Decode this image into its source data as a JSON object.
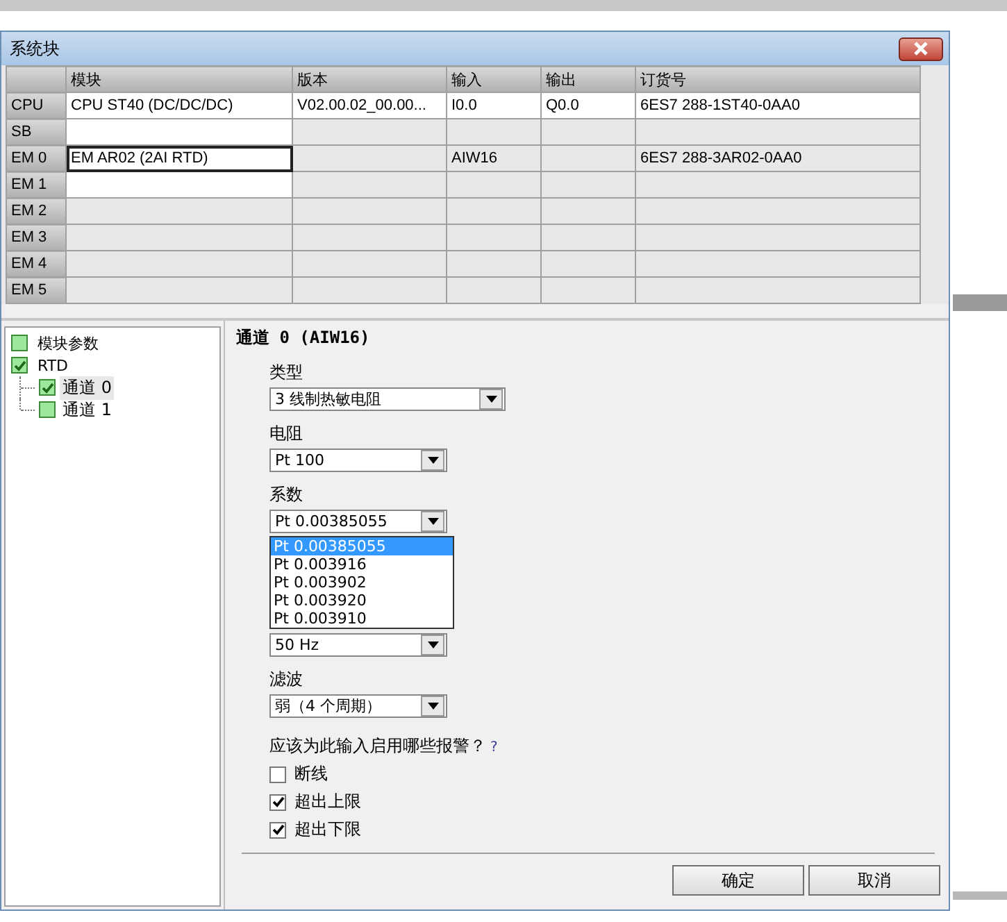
{
  "window": {
    "title": "系统块"
  },
  "table": {
    "columns": [
      "模块",
      "版本",
      "输入",
      "输出",
      "订货号"
    ],
    "rows": [
      {
        "header": "CPU",
        "cells": [
          {
            "text": "CPU ST40 (DC/DC/DC)",
            "editable": true,
            "focused": false
          },
          {
            "text": "V02.00.02_00.00...",
            "editable": true,
            "focused": false
          },
          {
            "text": "I0.0",
            "editable": true,
            "focused": false
          },
          {
            "text": "Q0.0",
            "editable": true,
            "focused": false
          },
          {
            "text": "6ES7 288-1ST40-0AA0",
            "editable": true,
            "focused": false
          }
        ]
      },
      {
        "header": "SB",
        "cells": [
          {
            "text": "",
            "editable": true,
            "focused": false
          },
          {
            "text": "",
            "editable": false,
            "focused": false
          },
          {
            "text": "",
            "editable": false,
            "focused": false
          },
          {
            "text": "",
            "editable": false,
            "focused": false
          },
          {
            "text": "",
            "editable": false,
            "focused": false
          }
        ]
      },
      {
        "header": "EM 0",
        "cells": [
          {
            "text": "EM AR02 (2AI RTD)",
            "editable": true,
            "focused": true
          },
          {
            "text": "",
            "editable": false,
            "focused": false
          },
          {
            "text": "AIW16",
            "editable": false,
            "focused": false
          },
          {
            "text": "",
            "editable": false,
            "focused": false
          },
          {
            "text": "6ES7 288-3AR02-0AA0",
            "editable": false,
            "focused": false
          }
        ]
      },
      {
        "header": "EM 1",
        "cells": [
          {
            "text": "",
            "editable": true,
            "focused": false
          },
          {
            "text": "",
            "editable": false,
            "focused": false
          },
          {
            "text": "",
            "editable": false,
            "focused": false
          },
          {
            "text": "",
            "editable": false,
            "focused": false
          },
          {
            "text": "",
            "editable": false,
            "focused": false
          }
        ]
      },
      {
        "header": "EM 2",
        "cells": [
          {
            "text": "",
            "editable": false,
            "focused": false
          },
          {
            "text": "",
            "editable": false,
            "focused": false
          },
          {
            "text": "",
            "editable": false,
            "focused": false
          },
          {
            "text": "",
            "editable": false,
            "focused": false
          },
          {
            "text": "",
            "editable": false,
            "focused": false
          }
        ]
      },
      {
        "header": "EM 3",
        "cells": [
          {
            "text": "",
            "editable": false,
            "focused": false
          },
          {
            "text": "",
            "editable": false,
            "focused": false
          },
          {
            "text": "",
            "editable": false,
            "focused": false
          },
          {
            "text": "",
            "editable": false,
            "focused": false
          },
          {
            "text": "",
            "editable": false,
            "focused": false
          }
        ]
      },
      {
        "header": "EM 4",
        "cells": [
          {
            "text": "",
            "editable": false,
            "focused": false
          },
          {
            "text": "",
            "editable": false,
            "focused": false
          },
          {
            "text": "",
            "editable": false,
            "focused": false
          },
          {
            "text": "",
            "editable": false,
            "focused": false
          },
          {
            "text": "",
            "editable": false,
            "focused": false
          }
        ]
      },
      {
        "header": "EM 5",
        "cells": [
          {
            "text": "",
            "editable": false,
            "focused": false
          },
          {
            "text": "",
            "editable": false,
            "focused": false
          },
          {
            "text": "",
            "editable": false,
            "focused": false
          },
          {
            "text": "",
            "editable": false,
            "focused": false
          },
          {
            "text": "",
            "editable": false,
            "focused": false
          }
        ]
      }
    ]
  },
  "tree": [
    {
      "label": "模块参数",
      "checked": false,
      "selected": false
    },
    {
      "label": "RTD",
      "checked": true,
      "selected": false,
      "children": [
        {
          "label": "通道 0",
          "checked": true,
          "selected": true
        },
        {
          "label": "通道 1",
          "checked": false,
          "selected": false
        }
      ]
    }
  ],
  "panel": {
    "heading": "通道 0 (AIW16)",
    "fields": [
      {
        "label": "类型",
        "value": "3 线制热敏电阻",
        "wide": true
      },
      {
        "label": "电阻",
        "value": "Pt 100",
        "wide": false
      },
      {
        "label": "系数",
        "value": "Pt 0.00385055",
        "wide": false,
        "open": true
      },
      {
        "value": "50 Hz",
        "wide": false
      },
      {
        "label": "滤波",
        "value": "弱（4 个周期）",
        "wide": false
      }
    ],
    "dropdown_options": [
      {
        "text": "Pt 0.00385055",
        "selected": true
      },
      {
        "text": "Pt 0.003916",
        "selected": false
      },
      {
        "text": "Pt 0.003902",
        "selected": false
      },
      {
        "text": "Pt 0.003920",
        "selected": false
      },
      {
        "text": "Pt 0.003910",
        "selected": false
      }
    ],
    "alarm_question": "应该为此输入启用哪些报警？",
    "help": "?",
    "alarms": [
      {
        "label": "断线",
        "checked": false
      },
      {
        "label": "超出上限",
        "checked": true
      },
      {
        "label": "超出下限",
        "checked": true
      }
    ]
  },
  "buttons": [
    "确定",
    "取消"
  ]
}
